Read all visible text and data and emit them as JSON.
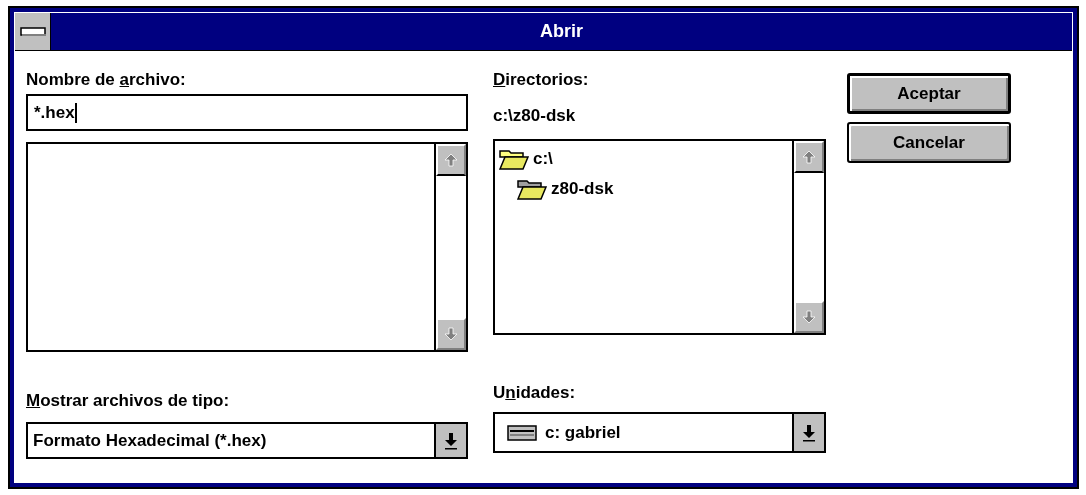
{
  "window": {
    "title": "Abrir"
  },
  "file_name": {
    "label_parts": [
      {
        "text": "Nombre de ",
        "underline": false
      },
      {
        "text": "a",
        "underline": true
      },
      {
        "text": "rchivo:",
        "underline": false
      }
    ],
    "value": "*.hex"
  },
  "file_type": {
    "label_parts": [
      {
        "text": "M",
        "underline": true
      },
      {
        "text": "ostrar archivos de tipo:",
        "underline": false
      }
    ],
    "value": "Formato Hexadecimal (*.hex)"
  },
  "directories": {
    "label_parts": [
      {
        "text": "D",
        "underline": true
      },
      {
        "text": "irectorios:",
        "underline": false
      }
    ],
    "path": "c:\\z80-dsk",
    "tree": [
      {
        "label": "c:\\",
        "children": [
          {
            "label": "z80-dsk"
          }
        ]
      }
    ]
  },
  "drives": {
    "label_parts": [
      {
        "text": "U",
        "underline": false
      },
      {
        "text": "n",
        "underline": true
      },
      {
        "text": "idades:",
        "underline": false
      }
    ],
    "value": "c: gabriel"
  },
  "buttons": [
    {
      "label": "Aceptar",
      "default": true
    },
    {
      "label": "Cancelar",
      "default": false
    }
  ]
}
